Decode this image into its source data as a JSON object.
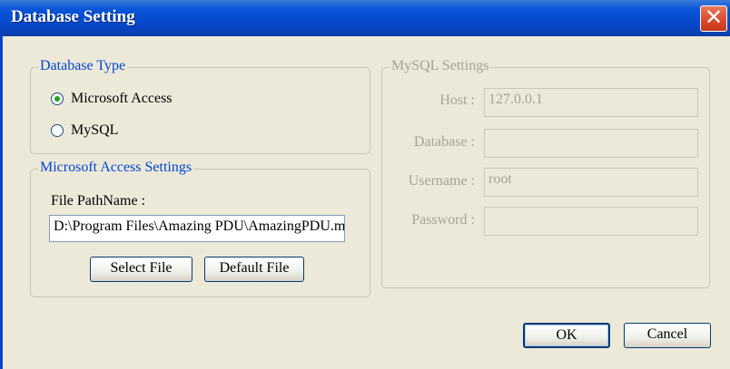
{
  "window": {
    "title": "Database Setting",
    "close_glyph": "✕"
  },
  "db_type": {
    "legend": "Database Type",
    "options": [
      {
        "label": "Microsoft Access",
        "selected": true
      },
      {
        "label": "MySQL",
        "selected": false
      }
    ]
  },
  "access": {
    "legend": "Microsoft Access Settings",
    "path_label": "File PathName :",
    "path_value": "D:\\Program Files\\Amazing PDU\\AmazingPDU.mdb",
    "select_button": "Select File",
    "default_button": "Default File"
  },
  "mysql": {
    "legend": "MySQL Settings",
    "host_label": "Host :",
    "host_value": "127.0.0.1",
    "database_label": "Database :",
    "database_value": "",
    "username_label": "Username :",
    "username_value": "root",
    "password_label": "Password :",
    "password_value": ""
  },
  "footer": {
    "ok": "OK",
    "cancel": "Cancel"
  },
  "colors": {
    "titlebar": "#0546c8",
    "close": "#d9482c",
    "selected_radio": "#21a121"
  }
}
